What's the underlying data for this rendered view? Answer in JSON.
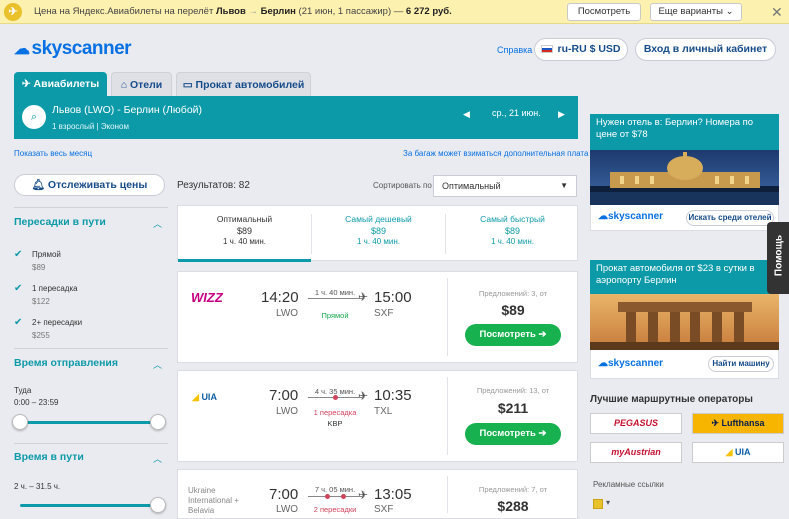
{
  "yandex_bar": {
    "text_prefix": "Цена на Яндекс.Авиабилеты на перелёт",
    "from": "Львов",
    "to": "Берлин",
    "details": "(21 июн, 1 пассажир)",
    "price": "6 272 руб.",
    "view_button": "Посмотреть",
    "more_button": "Еще варианты"
  },
  "header": {
    "logo": "skyscanner",
    "help": "Справка",
    "locale": "ru-RU $ USD",
    "login": "Вход в личный кабинет"
  },
  "tabs": [
    {
      "label": "Авиабилеты",
      "icon": "plane-icon"
    },
    {
      "label": "Отели",
      "icon": "bed-icon"
    },
    {
      "label": "Прокат автомобилей",
      "icon": "car-icon"
    }
  ],
  "search": {
    "route": "Львов (LWO) - Берлин (Любой)",
    "passengers": "1 взрослый",
    "cabin": "Эконом",
    "date": "ср., 21 июн."
  },
  "links": {
    "whole_month": "Показать весь месяц",
    "baggage": "За багаж может взиматься дополнительная плата"
  },
  "filters": {
    "track_prices": "Отслеживать цены",
    "stops_title": "Пересадки в пути",
    "stops": [
      {
        "label": "Прямой",
        "price": "$89"
      },
      {
        "label": "1 пересадка",
        "price": "$122"
      },
      {
        "label": "2+ пересадки",
        "price": "$255"
      }
    ],
    "departure_title": "Время отправления",
    "departure_label": "Туда",
    "departure_range": "0:00 – 23:59",
    "duration_title": "Время в пути",
    "duration_range": "2 ч. – 31.5 ч."
  },
  "results": {
    "count_label": "Результатов: 82",
    "sort_label": "Сортировать по",
    "sort_value": "Оптимальный",
    "sort_tabs": [
      {
        "label": "Оптимальный",
        "price": "$89",
        "duration": "1 ч. 40 мин."
      },
      {
        "label": "Самый дешевый",
        "price": "$89",
        "duration": "1 ч. 40 мин."
      },
      {
        "label": "Самый быстрый",
        "price": "$89",
        "duration": "1 ч. 40 мин."
      }
    ],
    "flights": [
      {
        "carrier": "WIZZ",
        "dep_time": "14:20",
        "dep_apt": "LWO",
        "duration": "1 ч. 40 мин.",
        "stops": "Прямой",
        "via": "",
        "arr_time": "15:00",
        "arr_apt": "SXF",
        "offers": "Предложений: 3, от",
        "price": "$89",
        "button": "Посмотреть"
      },
      {
        "carrier": "UIA",
        "dep_time": "7:00",
        "dep_apt": "LWO",
        "duration": "4 ч. 35 мин.",
        "stops": "1 пересадка",
        "via": "KBP",
        "arr_time": "10:35",
        "arr_apt": "TXL",
        "offers": "Предложений: 13, от",
        "price": "$211",
        "button": "Посмотреть"
      },
      {
        "carrier": "Ukraine International + Belavia",
        "dep_time": "7:00",
        "dep_apt": "LWO",
        "duration": "7 ч. 05 мин.",
        "stops": "2 пересадки",
        "via": "",
        "arr_time": "13:05",
        "arr_apt": "SXF",
        "offers": "Предложений: 7, от",
        "price": "$288",
        "button": "Посмотреть"
      }
    ]
  },
  "sidebar": {
    "hotel_promo": "Нужен отель в: Берлин? Номера по цене от $78",
    "hotel_button": "Искать среди отелей",
    "car_promo": "Прокат автомобиля от $23 в сутки в аэропорту Берлин",
    "car_button": "Найти машину",
    "promo_logo": "skyscanner",
    "operators_title": "Лучшие маршрутные операторы",
    "operators": [
      "PEGASUS",
      "Lufthansa",
      "myAustrian",
      "UIA"
    ],
    "ad_links": "Рекламные ссылки"
  },
  "help_tab": "Помощь",
  "colors": {
    "teal": "#0d9aa8",
    "green": "#17b14f",
    "blue": "#0770e3",
    "yandex": "#fdf1b0"
  }
}
